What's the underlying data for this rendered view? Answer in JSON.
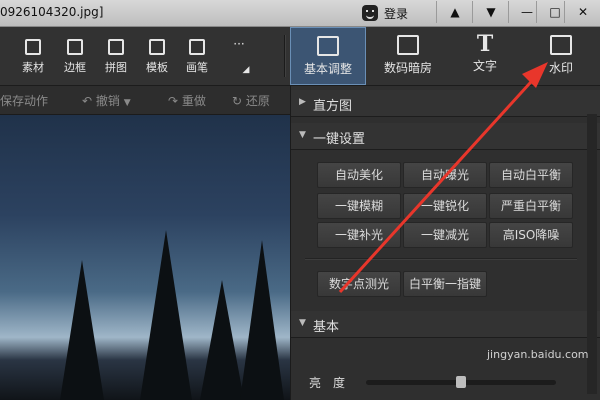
{
  "window": {
    "filename": "0926104320.jpg]",
    "login_label": "登录"
  },
  "toolbar": {
    "tools": [
      "素材",
      "边框",
      "拼图",
      "模板",
      "画笔"
    ],
    "more": "···",
    "tabs": [
      "基本调整",
      "数码暗房",
      "文字",
      "水印"
    ],
    "active_tab": "基本调整"
  },
  "subbar": {
    "save_action": "保存动作",
    "undo": "撤销",
    "redo": "重做",
    "restore": "还原"
  },
  "panel": {
    "histogram": "直方图",
    "oneclick": "一键设置",
    "buttons_row1": [
      "自动美化",
      "自动曝光",
      "自动白平衡"
    ],
    "buttons_row2": [
      "一键模糊",
      "一键锐化",
      "严重白平衡"
    ],
    "buttons_row3": [
      "一键补光",
      "一键减光",
      "高ISO降噪"
    ],
    "buttons_row4": [
      "数字点测光",
      "白平衡一指键"
    ],
    "basic": "基本",
    "brightness": "亮度"
  },
  "overlay": {
    "watermark_site": "jingyan.baidu.com",
    "accent": "#e8362b"
  }
}
